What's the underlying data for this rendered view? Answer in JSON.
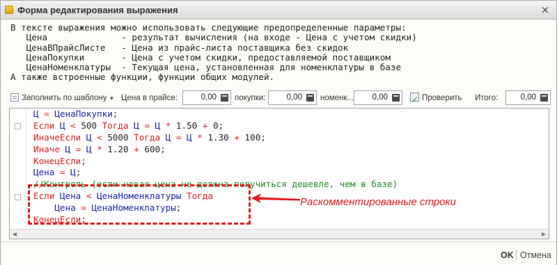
{
  "window": {
    "title": "Форма редактирования выражения",
    "close_label": "×"
  },
  "help_lines": [
    "В тексте выражения можно использовать следующие предопределенные параметры:",
    "   Цена              - результат вычисления (на входе - Цена с учетом скидки)",
    "   ЦенаВПрайсЛисте   - Цена из прайс-листа поставщика без скидок",
    "   ЦенаПокупки       - Цена с учетом скидки, предоставляемой поставщиком",
    "   ЦенаНоменклатуры  - Текущая цена, установленная для номенклатуры в базе",
    "А также встроенные функции, функции общих модулей."
  ],
  "toolbar": {
    "template_label": "Заполнить по шаблону",
    "price_list_label": "Цена в прайсе:",
    "price_list_value": "0,00",
    "purchase_label": "покупки:",
    "purchase_value": "0,00",
    "nomenclature_label": "номенк...",
    "nomenclature_value": "0,00",
    "check_label": "Проверить",
    "total_label": "Итого:",
    "total_value": "0,00"
  },
  "code_lines": [
    [
      [
        "id",
        "Ц"
      ],
      [
        "plain",
        " "
      ],
      [
        "op",
        "="
      ],
      [
        "plain",
        " "
      ],
      [
        "id",
        "ЦенаПокупки"
      ],
      [
        "plain",
        ";"
      ]
    ],
    [
      [
        "kw",
        "Если"
      ],
      [
        "plain",
        " "
      ],
      [
        "id",
        "Ц"
      ],
      [
        "plain",
        " "
      ],
      [
        "op",
        "<"
      ],
      [
        "plain",
        " "
      ],
      [
        "num",
        "500"
      ],
      [
        "plain",
        " "
      ],
      [
        "kw",
        "Тогда"
      ],
      [
        "plain",
        " "
      ],
      [
        "id",
        "Ц"
      ],
      [
        "plain",
        " "
      ],
      [
        "op",
        "="
      ],
      [
        "plain",
        " "
      ],
      [
        "id",
        "Ц"
      ],
      [
        "plain",
        " "
      ],
      [
        "op",
        "*"
      ],
      [
        "plain",
        " "
      ],
      [
        "num",
        "1.50"
      ],
      [
        "plain",
        " "
      ],
      [
        "op",
        "+"
      ],
      [
        "plain",
        " "
      ],
      [
        "num",
        "0"
      ],
      [
        "plain",
        ";"
      ]
    ],
    [
      [
        "kw",
        "ИначеЕсли"
      ],
      [
        "plain",
        " "
      ],
      [
        "id",
        "Ц"
      ],
      [
        "plain",
        " "
      ],
      [
        "op",
        "<"
      ],
      [
        "plain",
        " "
      ],
      [
        "num",
        "5000"
      ],
      [
        "plain",
        " "
      ],
      [
        "kw",
        "Тогда"
      ],
      [
        "plain",
        " "
      ],
      [
        "id",
        "Ц"
      ],
      [
        "plain",
        " "
      ],
      [
        "op",
        "="
      ],
      [
        "plain",
        " "
      ],
      [
        "id",
        "Ц"
      ],
      [
        "plain",
        " "
      ],
      [
        "op",
        "*"
      ],
      [
        "plain",
        " "
      ],
      [
        "num",
        "1.30"
      ],
      [
        "plain",
        " "
      ],
      [
        "op",
        "+"
      ],
      [
        "plain",
        " "
      ],
      [
        "num",
        "100"
      ],
      [
        "plain",
        ";"
      ]
    ],
    [
      [
        "kw",
        "Иначе"
      ],
      [
        "plain",
        " "
      ],
      [
        "id",
        "Ц"
      ],
      [
        "plain",
        " "
      ],
      [
        "op",
        "="
      ],
      [
        "plain",
        " "
      ],
      [
        "id",
        "Ц"
      ],
      [
        "plain",
        " "
      ],
      [
        "op",
        "*"
      ],
      [
        "plain",
        " "
      ],
      [
        "num",
        "1.20"
      ],
      [
        "plain",
        " "
      ],
      [
        "op",
        "+"
      ],
      [
        "plain",
        " "
      ],
      [
        "num",
        "600"
      ],
      [
        "plain",
        ";"
      ]
    ],
    [
      [
        "kw",
        "КонецЕсли"
      ],
      [
        "plain",
        ";"
      ]
    ],
    [
      [
        "id",
        "Цена"
      ],
      [
        "plain",
        " "
      ],
      [
        "op",
        "="
      ],
      [
        "plain",
        " "
      ],
      [
        "id",
        "Ц"
      ],
      [
        "plain",
        ";"
      ]
    ],
    [
      [
        "cm",
        "//Контроль (если новая цена не должна получиться дешевле, чем в базе)"
      ]
    ],
    [
      [
        "kw",
        "Если"
      ],
      [
        "plain",
        " "
      ],
      [
        "id",
        "Цена"
      ],
      [
        "plain",
        " "
      ],
      [
        "op",
        "<"
      ],
      [
        "plain",
        " "
      ],
      [
        "id",
        "ЦенаНоменклатуры"
      ],
      [
        "plain",
        " "
      ],
      [
        "kw",
        "Тогда"
      ]
    ],
    [
      [
        "plain",
        "    "
      ],
      [
        "id",
        "Цена"
      ],
      [
        "plain",
        " "
      ],
      [
        "op",
        "="
      ],
      [
        "plain",
        " "
      ],
      [
        "id",
        "ЦенаНоменклатуры"
      ],
      [
        "plain",
        ";"
      ]
    ],
    [
      [
        "kw",
        "КонецЕсли"
      ],
      [
        "plain",
        ";"
      ]
    ]
  ],
  "annotation": {
    "callout_text": "Раскомментированные строки"
  },
  "footer": {
    "ok_label": "OK",
    "cancel_label": "Отмена"
  },
  "colors": {
    "keyword": "#e0201e",
    "identifier": "#1a24b0",
    "comment": "#1f8a1f",
    "annotation": "#e21b1b"
  }
}
